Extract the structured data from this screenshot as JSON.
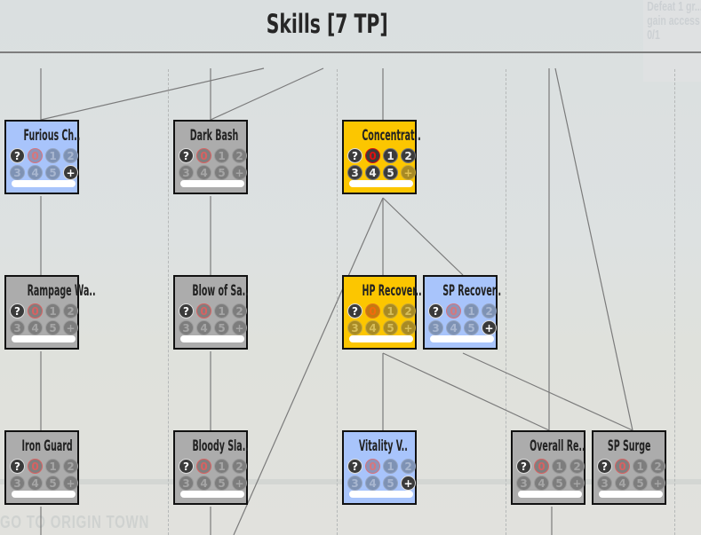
{
  "header": {
    "title": "Skills [7 TP]"
  },
  "side_panel": {
    "lines": [
      "Defeat 1 gr...",
      "gain access",
      "0/1"
    ]
  },
  "background_text": "GO TO ORIGIN TOWN",
  "circle_labels": [
    "?",
    "0",
    "1",
    "2",
    "3",
    "4",
    "5",
    "+"
  ],
  "colors": {
    "learnable": "#a8c4fb",
    "locked": "#acacac",
    "learned": "#fcc600",
    "rank_zero": "#d86161"
  },
  "skills": [
    {
      "id": "furious-charge",
      "name": "Furious Ch..",
      "state": "learnable",
      "rank": 0,
      "max_rank": 5,
      "can_add": true
    },
    {
      "id": "dark-bash",
      "name": "Dark Bash",
      "state": "locked",
      "rank": 0,
      "max_rank": 5,
      "can_add": false
    },
    {
      "id": "concentration",
      "name": "Concentrat..",
      "state": "learned",
      "rank": 5,
      "max_rank": 5,
      "can_add": false
    },
    {
      "id": "rampage-wave",
      "name": "Rampage Wa..",
      "state": "locked",
      "rank": 0,
      "max_rank": 5,
      "can_add": false
    },
    {
      "id": "blow-of-sacrifice",
      "name": "Blow of Sa..",
      "state": "locked",
      "rank": 0,
      "max_rank": 5,
      "can_add": false
    },
    {
      "id": "hp-recovery",
      "name": "HP Recover..",
      "state": "learned",
      "rank": 0,
      "max_rank": 5,
      "can_add": false
    },
    {
      "id": "sp-recovery",
      "name": "SP Recover..",
      "state": "learnable",
      "rank": 0,
      "max_rank": 5,
      "can_add": true
    },
    {
      "id": "iron-guard",
      "name": "Iron Guard",
      "state": "locked",
      "rank": 0,
      "max_rank": 5,
      "can_add": false
    },
    {
      "id": "bloody-slash",
      "name": "Bloody Sla..",
      "state": "locked",
      "rank": 0,
      "max_rank": 5,
      "can_add": false
    },
    {
      "id": "vitality-v",
      "name": "Vitality V..",
      "state": "learnable",
      "rank": 0,
      "max_rank": 5,
      "can_add": true
    },
    {
      "id": "overall-re",
      "name": "Overall Re..",
      "state": "locked",
      "rank": 0,
      "max_rank": 5,
      "can_add": false
    },
    {
      "id": "sp-surge",
      "name": "SP Surge",
      "state": "locked",
      "rank": 0,
      "max_rank": 5,
      "can_add": false
    }
  ]
}
